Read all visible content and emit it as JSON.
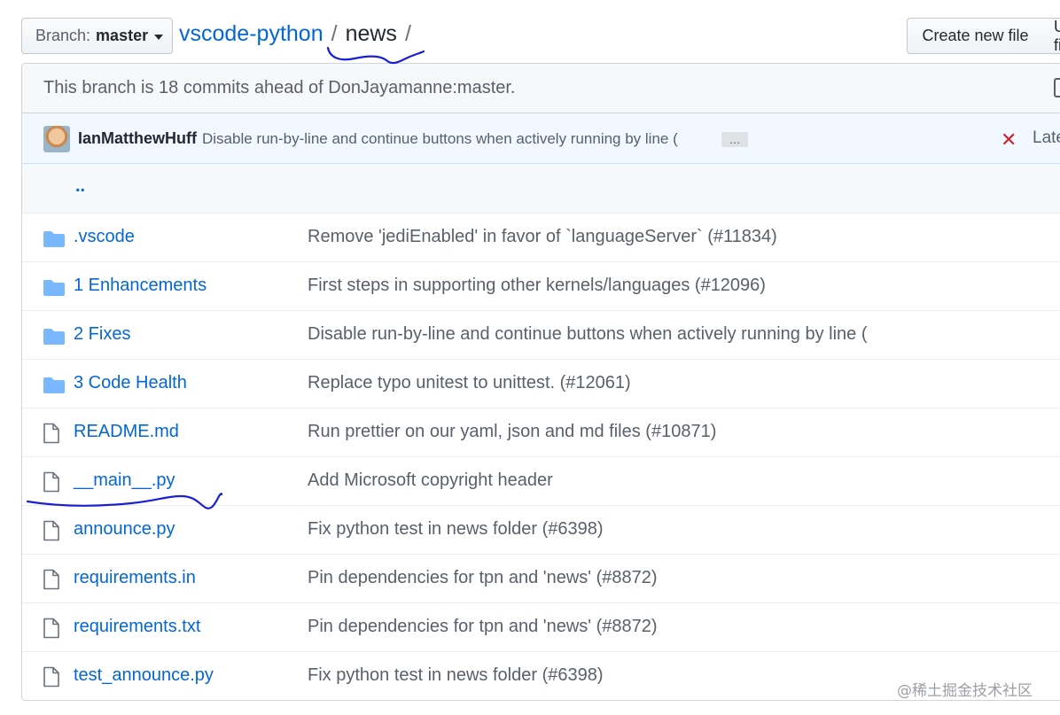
{
  "header": {
    "branch_label": "Branch:",
    "branch_name": "master",
    "repo_name": "vscode-python",
    "separator": "/",
    "current_dir": "news",
    "trailing_sep": "/",
    "create_button": "Create new file",
    "upload_button": "Upload files"
  },
  "ahead_notice": "This branch is 18 commits ahead of DonJayamanne:master.",
  "latest_commit": {
    "author": "IanMatthewHuff",
    "message": "Disable run-by-line and continue buttons when actively running by line (",
    "ellipsis": "…",
    "status": "✕",
    "latest_label": "Latest commit"
  },
  "parent_link": "..",
  "files": [
    {
      "type": "folder",
      "name": ".vscode",
      "message": "Remove 'jediEnabled' in favor of `languageServer` (#11834)"
    },
    {
      "type": "folder",
      "name": "1 Enhancements",
      "message": "First steps in supporting other kernels/languages (#12096)"
    },
    {
      "type": "folder",
      "name": "2 Fixes",
      "message": "Disable run-by-line and continue buttons when actively running by line ("
    },
    {
      "type": "folder",
      "name": "3 Code Health",
      "message": "Replace typo unitest to unittest. (#12061)"
    },
    {
      "type": "file",
      "name": "README.md",
      "message": "Run prettier on our yaml, json and md files (#10871)"
    },
    {
      "type": "file",
      "name": "__main__.py",
      "message": "Add Microsoft copyright header"
    },
    {
      "type": "file",
      "name": "announce.py",
      "message": "Fix python test in news folder (#6398)"
    },
    {
      "type": "file",
      "name": "requirements.in",
      "message": "Pin dependencies for tpn and 'news' (#8872)"
    },
    {
      "type": "file",
      "name": "requirements.txt",
      "message": "Pin dependencies for tpn and 'news' (#8872)"
    },
    {
      "type": "file",
      "name": "test_announce.py",
      "message": "Fix python test in news folder (#6398)"
    }
  ],
  "colors": {
    "link": "#0366d6",
    "folder_icon": "#79b8ff",
    "annotation_ink": "#1a1fd6"
  },
  "watermark": "@稀土掘金技术社区"
}
